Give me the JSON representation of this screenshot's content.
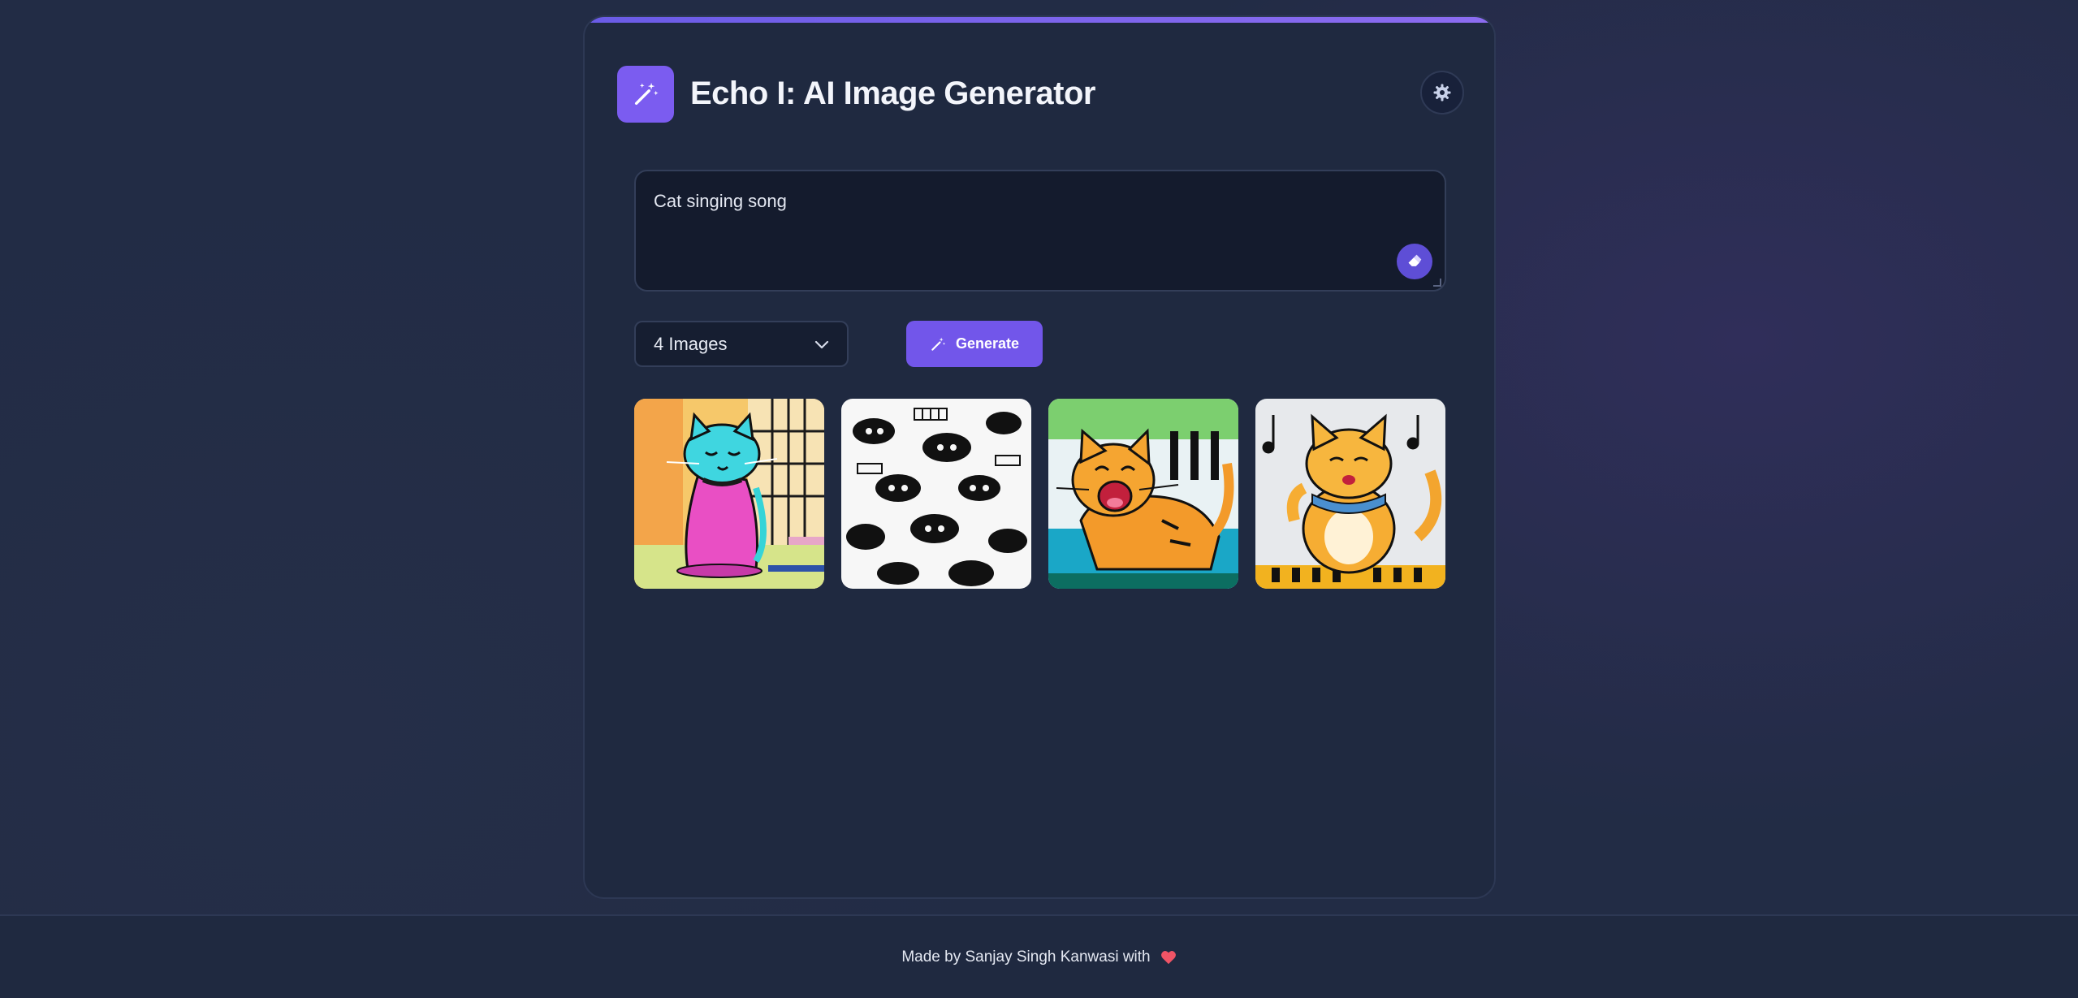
{
  "header": {
    "title": "Echo I: AI Image Generator",
    "logo_icon": "magic-wand-icon",
    "settings_icon": "gear-icon"
  },
  "prompt": {
    "value": "Cat singing song",
    "action_icon": "eraser-icon"
  },
  "controls": {
    "image_count": "4 Images",
    "generate_label": "Generate",
    "generate_icon": "magic-wand-icon"
  },
  "gallery": {
    "images": [
      {
        "name": "generated-image-1",
        "description_icon": "image"
      },
      {
        "name": "generated-image-2",
        "description_icon": "image"
      },
      {
        "name": "generated-image-3",
        "description_icon": "image"
      },
      {
        "name": "generated-image-4",
        "description_icon": "image"
      }
    ]
  },
  "footer": {
    "text": "Made by Sanjay Singh Kanwasi with",
    "heart_icon": "heart-icon"
  },
  "colors": {
    "accent": "#7256ea",
    "background": "#222c45",
    "card": "#1f2940",
    "heart": "#ef5466"
  }
}
